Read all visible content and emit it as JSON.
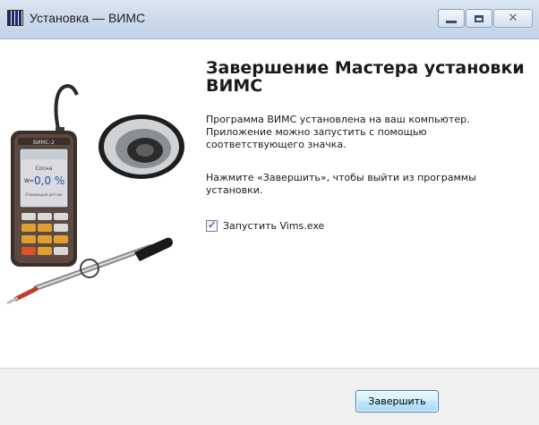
{
  "window": {
    "title": "Установка — ВИМС",
    "close_glyph": "✕"
  },
  "content": {
    "heading": "Завершение Мастера установки ВИМС",
    "paragraph1": "Программа ВИМС установлена на ваш компьютер. Приложение можно запустить с помощью соответствующего значка.",
    "paragraph2": "Нажмите «Завершить», чтобы выйти из программы установки.",
    "run_checkbox": {
      "label": "Запустить Vims.exe",
      "checked": true,
      "tick": "✓"
    }
  },
  "device": {
    "brand": "ВИМС-2",
    "mode": "Сосна",
    "reading": "0,0 %",
    "reading_prefix": "W=",
    "subtitle": "Плавающий датчик"
  },
  "footer": {
    "finish_label": "Завершить"
  },
  "colors": {
    "titlebar": "#c8d7ea",
    "footer": "#f0f0f0",
    "button_border": "#3c7fb1"
  }
}
